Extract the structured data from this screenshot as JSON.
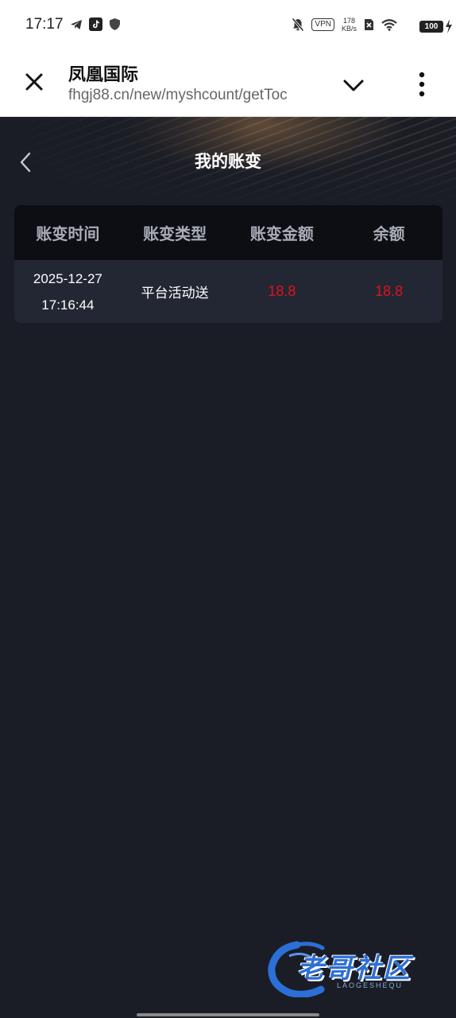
{
  "status_bar": {
    "time": "17:17",
    "vpn_label": "VPN",
    "net_speed_value": "178",
    "net_speed_unit": "KB/s",
    "battery": "100",
    "icons": [
      "telegram-icon",
      "tiktok-icon",
      "shield-icon",
      "mute-icon",
      "vpn-icon",
      "sim-icon",
      "wifi-icon",
      "battery-icon",
      "charging-icon"
    ]
  },
  "browser": {
    "title": "凤凰国际",
    "url": "fhgj88.cn/new/myshcount/getToc"
  },
  "page": {
    "title": "我的账变"
  },
  "table": {
    "headers": [
      "账变时间",
      "账变类型",
      "账变金额",
      "余额"
    ],
    "rows": [
      {
        "date": "2025-12-27",
        "time": "17:16:44",
        "type": "平台活动送",
        "amount": "18.8",
        "balance": "18.8"
      }
    ]
  },
  "watermark": {
    "text": "老哥社区",
    "sub": "LAOGESHEQU"
  },
  "colors": {
    "background": "#1a1d26",
    "table_header": "#0c0e13",
    "table_row": "#232733",
    "amount_red": "#e0121c"
  }
}
